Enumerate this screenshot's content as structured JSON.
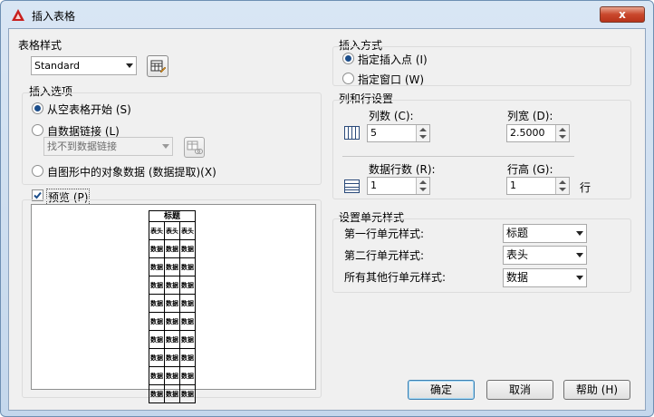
{
  "window": {
    "title": "插入表格",
    "close_label": "x"
  },
  "table_style": {
    "heading": "表格样式",
    "selected": "Standard"
  },
  "insert_options": {
    "heading": "插入选项",
    "from_empty": "从空表格开始 (S)",
    "from_data_link": "自数据链接 (L)",
    "data_link_placeholder": "找不到数据链接",
    "from_object_data": "自图形中的对象数据 (数据提取)(X)"
  },
  "preview": {
    "label": "预览 (P)",
    "checked": true,
    "table_title": "标题",
    "header_row": [
      "表头",
      "表头",
      "表头"
    ],
    "data_rows": [
      [
        "数据",
        "数据",
        "数据"
      ],
      [
        "数据",
        "数据",
        "数据"
      ],
      [
        "数据",
        "数据",
        "数据"
      ],
      [
        "数据",
        "数据",
        "数据"
      ],
      [
        "数据",
        "数据",
        "数据"
      ],
      [
        "数据",
        "数据",
        "数据"
      ],
      [
        "数据",
        "数据",
        "数据"
      ],
      [
        "数据",
        "数据",
        "数据"
      ],
      [
        "数据",
        "数据",
        "数据"
      ]
    ]
  },
  "insert_method": {
    "heading": "插入方式",
    "specify_point": "指定插入点 (I)",
    "specify_window": "指定窗口 (W)"
  },
  "columns_rows": {
    "heading": "列和行设置",
    "columns_label": "列数 (C):",
    "columns_value": "5",
    "col_width_label": "列宽 (D):",
    "col_width_value": "2.5000",
    "data_rows_label": "数据行数 (R):",
    "data_rows_value": "1",
    "row_height_label": "行高 (G):",
    "row_height_value": "1",
    "row_unit": "行"
  },
  "cell_styles": {
    "heading": "设置单元样式",
    "first_row_label": "第一行单元样式:",
    "first_row_value": "标题",
    "second_row_label": "第二行单元样式:",
    "second_row_value": "表头",
    "other_rows_label": "所有其他行单元样式:",
    "other_rows_value": "数据"
  },
  "buttons": {
    "ok": "确定",
    "cancel": "取消",
    "help": "帮助 (H)"
  }
}
